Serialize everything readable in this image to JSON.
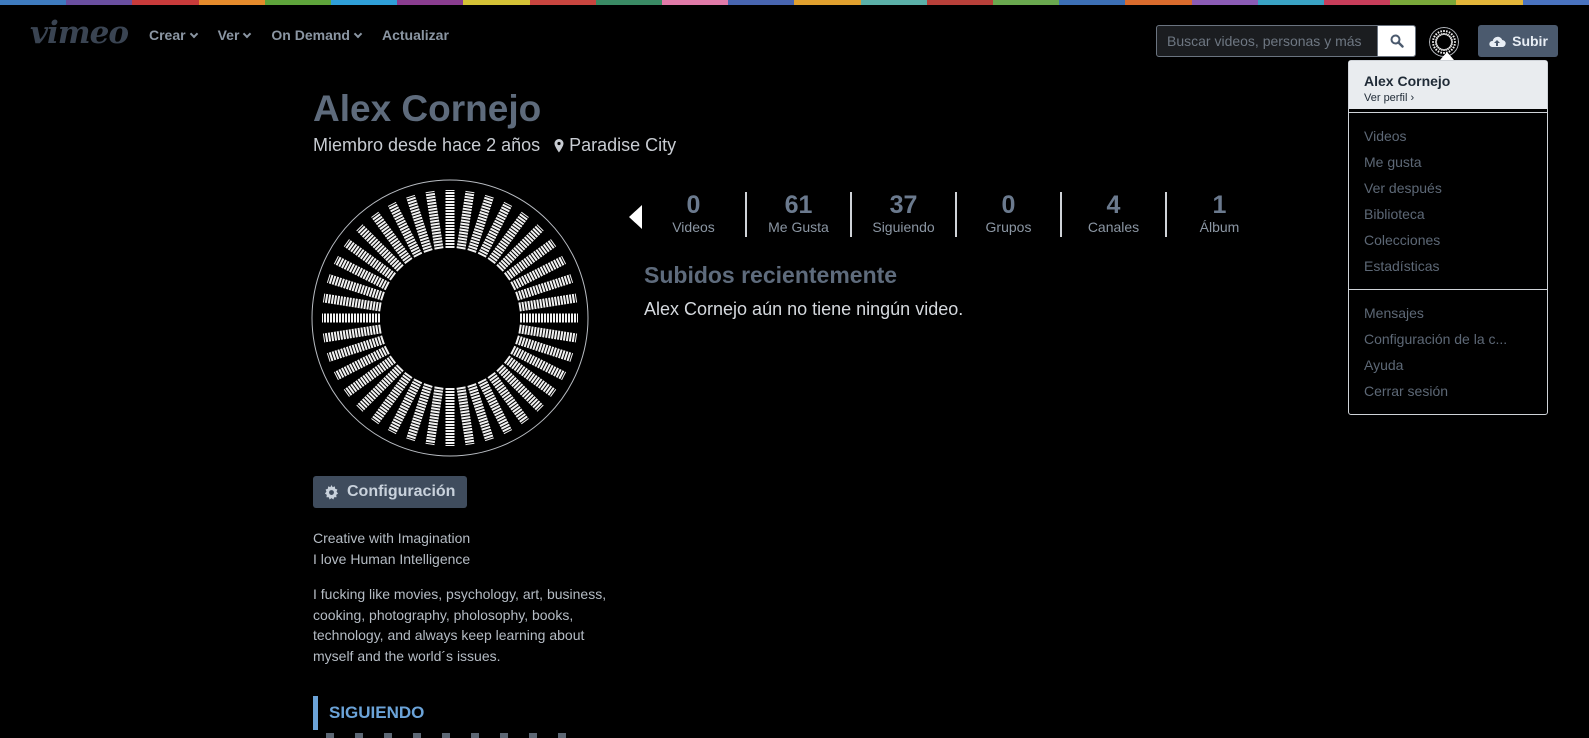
{
  "nav": {
    "logo": "vimeo",
    "links": [
      {
        "label": "Crear",
        "dropdown": true
      },
      {
        "label": "Ver",
        "dropdown": true
      },
      {
        "label": "On Demand",
        "dropdown": true
      },
      {
        "label": "Actualizar",
        "dropdown": false
      }
    ],
    "search_placeholder": "Buscar videos, personas y más",
    "upload_label": "Subir",
    "search_icon": "search-icon",
    "upload_icon": "cloud-upload-icon"
  },
  "user_menu": {
    "name": "Alex Cornejo",
    "profile_link": "Ver perfil ›",
    "group1": [
      "Videos",
      "Me gusta",
      "Ver después",
      "Biblioteca",
      "Colecciones",
      "Estadísticas"
    ],
    "group2": [
      "Mensajes",
      "Configuración de la c...",
      "Ayuda",
      "Cerrar sesión"
    ]
  },
  "profile": {
    "name": "Alex Cornejo",
    "member_since": "Miembro desde hace 2 años",
    "location": "Paradise City",
    "config_label": "Configuración",
    "bio_short": [
      "Creative with Imagination",
      "I love Human Intelligence"
    ],
    "bio_long": "I fucking like movies, psychology, art, business, cooking, photography, pholosophy, books, technology, and always keep learning about myself and the world´s issues.",
    "following_label": "SIGUIENDO"
  },
  "stats": [
    {
      "value": "0",
      "label": "Videos"
    },
    {
      "value": "61",
      "label": "Me Gusta"
    },
    {
      "value": "37",
      "label": "Siguiendo"
    },
    {
      "value": "0",
      "label": "Grupos"
    },
    {
      "value": "4",
      "label": "Canales"
    },
    {
      "value": "1",
      "label": "Álbum"
    }
  ],
  "recent": {
    "title": "Subidos recientemente",
    "empty_text": "Alex Cornejo aún no tiene ningún video."
  },
  "colors": {
    "rainbow": [
      "#3e7bbf",
      "#6a4fa0",
      "#c83b3b",
      "#e58b2c",
      "#5ea43b",
      "#2f9fd8",
      "#8a3d8f",
      "#d4c236",
      "#c8453f",
      "#3a8a64",
      "#e07aa8",
      "#4865b0",
      "#e0a02e",
      "#5bb0a8",
      "#b8403a",
      "#6aa84f",
      "#3c6fb5",
      "#d96b2d",
      "#8b5cb5",
      "#3aa3c4",
      "#c73d5a",
      "#79a83a",
      "#e3b63a",
      "#4a73c0"
    ],
    "accent": "#6ba3d8",
    "button_bg": "#4b5a6e"
  }
}
